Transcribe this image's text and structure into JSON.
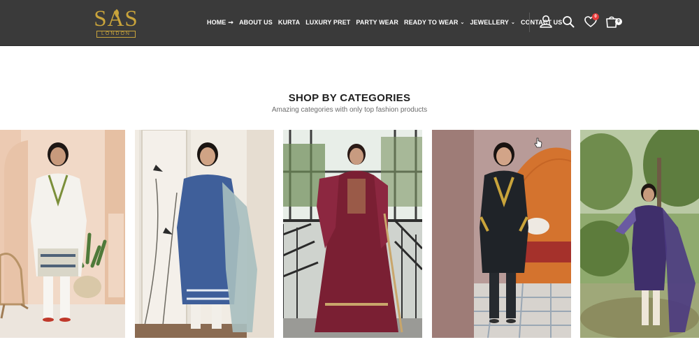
{
  "header": {
    "logo_text": "SAS",
    "logo_sub": "LONDON",
    "nav": [
      {
        "label": "HOME",
        "suffix": "➞"
      },
      {
        "label": "ABOUT US",
        "suffix": ""
      },
      {
        "label": "KURTA",
        "suffix": ""
      },
      {
        "label": "LUXURY PRET",
        "suffix": ""
      },
      {
        "label": "PARTY WEAR",
        "suffix": ""
      },
      {
        "label": "READY TO WEAR",
        "suffix": "⌄"
      },
      {
        "label": "JEWELLERY",
        "suffix": "⌄"
      },
      {
        "label": "CONTACT US",
        "suffix": ""
      }
    ],
    "wishlist_count": "0",
    "cart_count": "0"
  },
  "section": {
    "title": "SHOP BY CATEGORIES",
    "subtitle": "Amazing categories with only top fashion products"
  },
  "colors": {
    "header_bg": "#3a3a3a",
    "gold": "#c9a43b",
    "wishlist_badge": "#e63b3b"
  },
  "icons": [
    "user-icon",
    "search-icon",
    "heart-icon",
    "shopping-bag-icon",
    "arrow-right-icon",
    "chevron-down-icon"
  ]
}
